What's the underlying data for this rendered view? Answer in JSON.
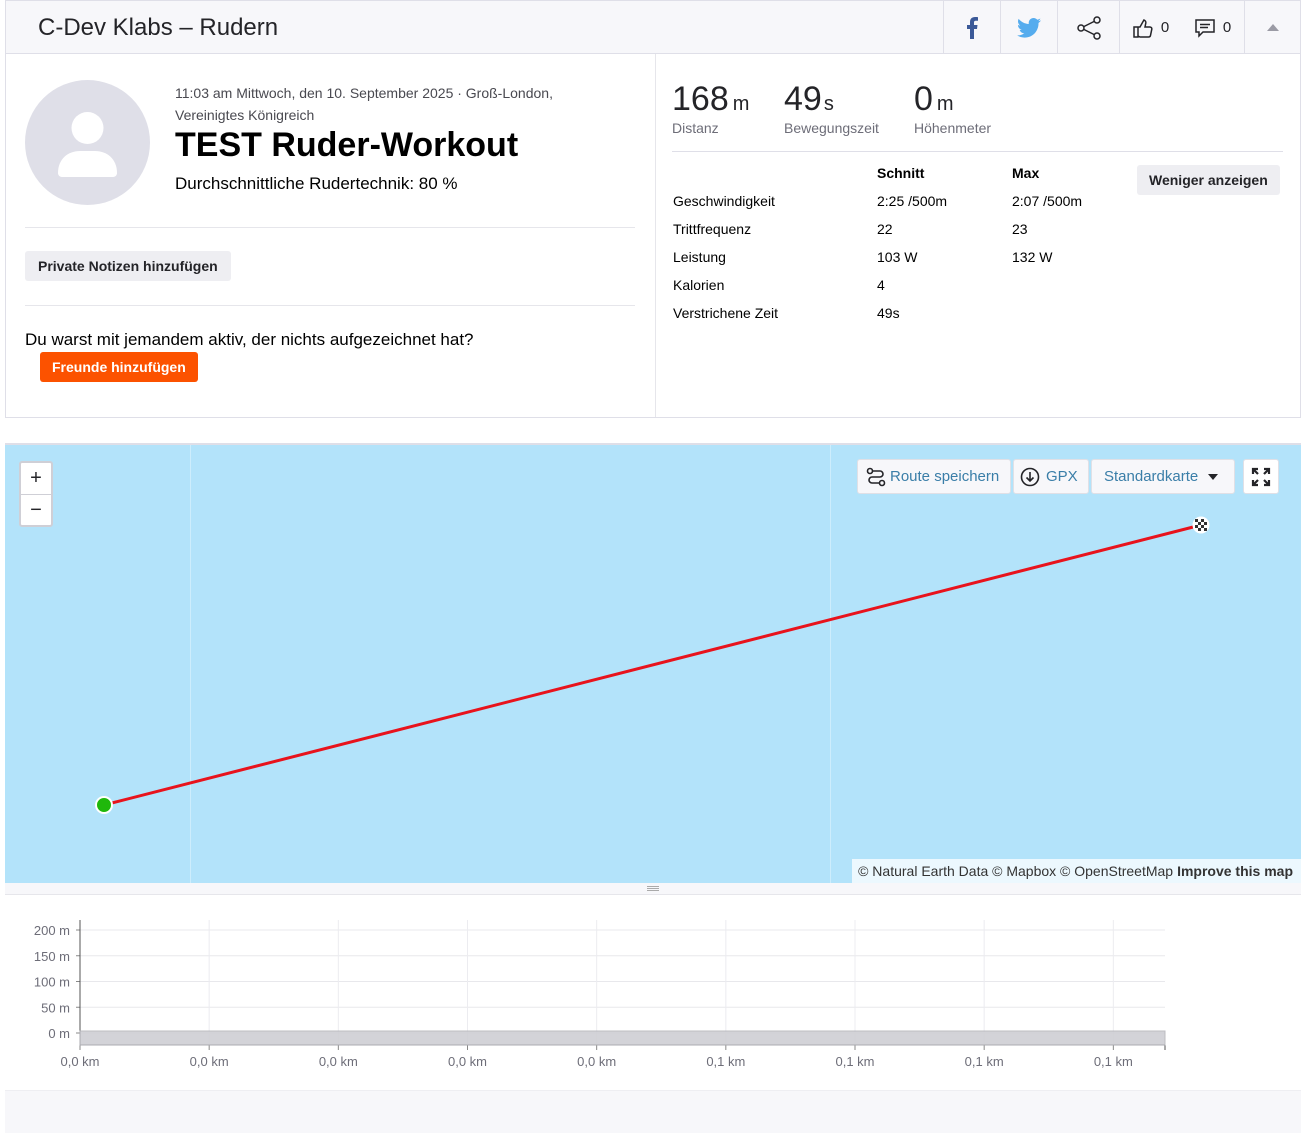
{
  "header": {
    "title": "C-Dev Klabs – Rudern",
    "icons": [
      "facebook-icon",
      "twitter-icon",
      "share-icon",
      "thumbs-up-icon",
      "comment-icon",
      "caret-up-icon"
    ],
    "kudos_count": "0",
    "comment_count": "0"
  },
  "activity": {
    "meta": "11:03 am Mittwoch, den 10. September 2025 · Groß-London, Vereinigtes Königreich",
    "title": "TEST Ruder-Workout",
    "technique": "Durchschnittliche Rudertechnik: 80 %",
    "notes_button": "Private Notizen hinzufügen",
    "question": "Du warst mit jemandem aktiv, der nichts aufgezeichnet hat?",
    "friends_button": "Freunde hinzufügen"
  },
  "stats": {
    "primary": [
      {
        "value": "168",
        "unit": "m",
        "label": "Distanz"
      },
      {
        "value": "49",
        "unit": "s",
        "label": "Bewegungszeit"
      },
      {
        "value": "0",
        "unit": "m",
        "label": "Höhenmeter"
      }
    ],
    "table_header": {
      "col1": "Schnitt",
      "col2": "Max"
    },
    "rows": [
      {
        "label": "Geschwindigkeit",
        "avg": "2:25 /500m",
        "max": "2:07 /500m"
      },
      {
        "label": "Trittfrequenz",
        "avg": "22",
        "max": "23"
      },
      {
        "label": "Leistung",
        "avg": "103 W",
        "max": "132 W"
      },
      {
        "label": "Kalorien",
        "avg": "4",
        "max": ""
      },
      {
        "label": "Verstrichene Zeit",
        "avg": "49s",
        "max": ""
      }
    ],
    "less_button": "Weniger anzeigen"
  },
  "map": {
    "zoom_in": "+",
    "zoom_out": "−",
    "save_route": "Route speichern",
    "gpx": "GPX",
    "map_type": "Standardkarte",
    "attribution": "© Natural Earth Data © Mapbox © OpenStreetMap",
    "improve": "Improve this map",
    "water_color": "#b3e3fa",
    "route_color": "#e8131c",
    "start_color": "#1fb80b"
  },
  "chart_data": {
    "type": "area",
    "y_ticks": [
      "200 m",
      "150 m",
      "100 m",
      "50 m",
      "0 m"
    ],
    "x_ticks": [
      "0,0 km",
      "0,0 km",
      "0,0 km",
      "0,0 km",
      "0,0 km",
      "0,1 km",
      "0,1 km",
      "0,1 km",
      "0,1 km"
    ],
    "ylim": [
      0,
      200
    ],
    "series": [
      {
        "values": [
          0,
          0,
          0,
          0,
          0,
          0,
          0,
          0,
          0
        ]
      }
    ],
    "grid": true
  }
}
